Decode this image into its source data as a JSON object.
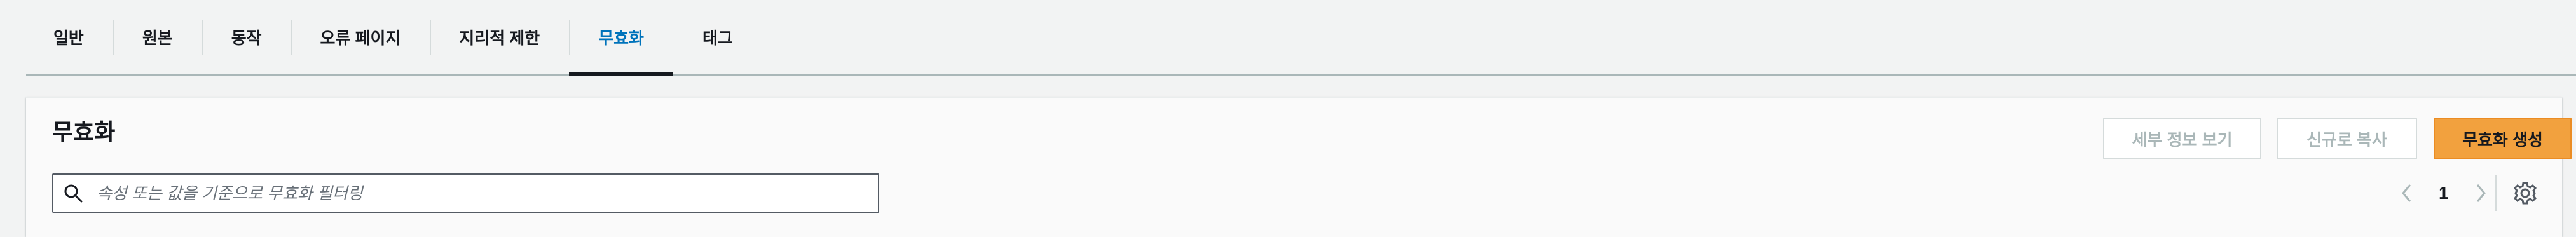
{
  "tabs": [
    {
      "label": "일반",
      "active": false
    },
    {
      "label": "원본",
      "active": false
    },
    {
      "label": "동작",
      "active": false
    },
    {
      "label": "오류 페이지",
      "active": false
    },
    {
      "label": "지리적 제한",
      "active": false
    },
    {
      "label": "무효화",
      "active": true
    },
    {
      "label": "태그",
      "active": false
    }
  ],
  "panel": {
    "title": "무효화",
    "buttons": {
      "details": "세부 정보 보기",
      "copy": "신규로 복사",
      "create": "무효화 생성"
    },
    "search": {
      "placeholder": "속성 또는 값을 기준으로 무효화 필터링",
      "value": ""
    },
    "pagination": {
      "current_page": "1"
    }
  },
  "colors": {
    "accent": "#0073bb",
    "primary_button": "#f2a13e",
    "background": "#f2f3f3"
  },
  "icons": [
    "search-icon",
    "chevron-left-icon",
    "chevron-right-icon",
    "gear-icon"
  ]
}
